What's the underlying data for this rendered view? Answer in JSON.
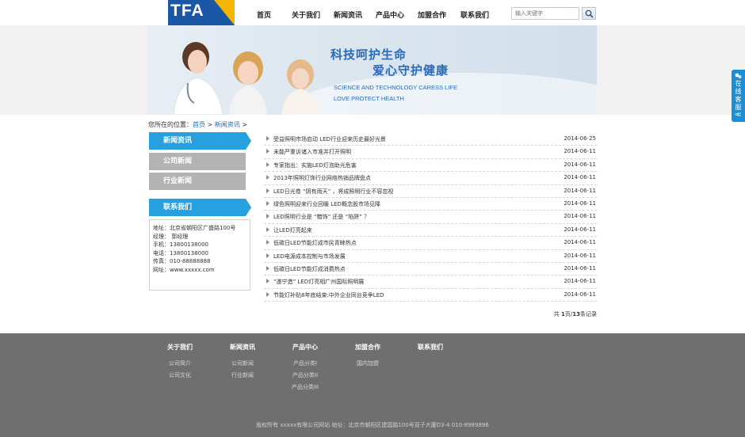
{
  "header": {
    "logo_text": "TFA",
    "nav": [
      "首页",
      "关于我们",
      "新闻资讯",
      "产品中心",
      "加盟合作",
      "联系我们"
    ],
    "search_placeholder": "输入关键字"
  },
  "banner": {
    "slogan_line1": "科技呵护生命",
    "slogan_line2": "爱心守护健康",
    "slogan_en_line1": "SCIENCE AND TECHNOLOGY CARESS LIFE",
    "slogan_en_line2": "LOVE PROTECT HEALTH"
  },
  "breadcrumb": {
    "prefix": "您所在的位置：",
    "home": "首页",
    "sep": " > ",
    "current": "新闻资讯"
  },
  "sidebar": {
    "tabs": [
      "新闻资讯",
      "公司新闻",
      "行业新闻"
    ],
    "contact_title": "联系我们",
    "contact_lines": [
      "地址：北京省朝阳区广盛路100号",
      "经理： 郭经理",
      "手机：13800138000",
      "电话：13800138000",
      "传真：010-88888888",
      "网址：www.xxxxx.com"
    ]
  },
  "news": [
    {
      "title": "受益照明市场启动 LED行业迎来历史最好光景",
      "date": "2014-06-25"
    },
    {
      "title": "未能严重诉诸入市准并打开照明",
      "date": "2014-06-11"
    },
    {
      "title": "专家指出：实施LED灯泡助光危害",
      "date": "2014-06-11"
    },
    {
      "title": "2013年照明灯饰行业网络热销品牌盘点",
      "date": "2014-06-11"
    },
    {
      "title": "LED日光卷 “阴有雨天” ，将成照明行业不容忽视",
      "date": "2014-06-11"
    },
    {
      "title": "绿色照明迎来行业回暖 LED概念股市场见降",
      "date": "2014-06-11"
    },
    {
      "title": "LED照明行业是 “黯饰” 还是 “陷阱” ？",
      "date": "2014-06-11"
    },
    {
      "title": "让LED灯亮起来",
      "date": "2014-06-11"
    },
    {
      "title": "低碳日LED节能灯成市民青睐热点",
      "date": "2014-06-11"
    },
    {
      "title": "LED电源成本控制与市场发展",
      "date": "2014-06-11"
    },
    {
      "title": "低碳日LED节能灯成消费热点",
      "date": "2014-06-11"
    },
    {
      "title": "“遂宁造” LED灯亮相广州国际照明展",
      "date": "2014-06-11"
    },
    {
      "title": "节能灯补贴8年底结束:中外企业同台竞争LED",
      "date": "2014-06-11"
    }
  ],
  "pager": {
    "text1": "共 ",
    "page": "1",
    "text2": "页/",
    "count": "13",
    "text3": "条记录"
  },
  "footer": {
    "columns": [
      {
        "heading": "关于我们",
        "items": [
          "公司简介",
          "公司文化"
        ]
      },
      {
        "heading": "新闻资讯",
        "items": [
          "公司新闻",
          "行业新闻"
        ]
      },
      {
        "heading": "产品中心",
        "items": [
          "产品分类I",
          "产品分类II",
          "产品分类III"
        ]
      },
      {
        "heading": "加盟合作",
        "items": [
          "国内加盟"
        ]
      },
      {
        "heading": "联系我们",
        "items": []
      }
    ],
    "copyright": "版权所有 xxxxx有限公司网站 地址：北京市朝阳区建国路100号双子大厦D3-4 010-8989896"
  },
  "service": {
    "text": "在线客服",
    "chevron": "≪"
  }
}
